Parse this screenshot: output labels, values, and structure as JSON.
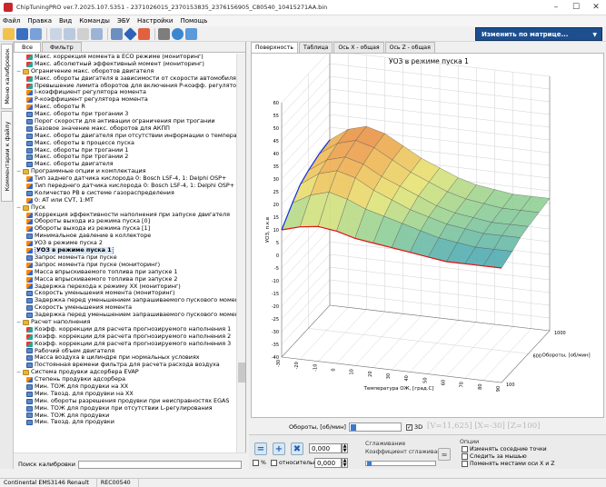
{
  "window": {
    "title": "ChipTuningPRO ver.7.2025.107.5351 - 237102601S_2370153835_2376156905_C80540_10415271AA.bin"
  },
  "menu": [
    "Файл",
    "Правка",
    "Вид",
    "Команды",
    "ЭБУ",
    "Настройки",
    "Помощь"
  ],
  "toolbar": {
    "change_matrix_label": "Изменить по матрице...",
    "change_matrix_arrow": "▼"
  },
  "side_tabs": {
    "calibrations": "Меню калибровок",
    "comments": "Комментарии к файлу"
  },
  "left_tabs": [
    "Все",
    "Фильтр"
  ],
  "tree": [
    {
      "depth": 2,
      "type": "map3d",
      "label": "Макс. коррекция момента в ECO режиме (мониторинг)"
    },
    {
      "depth": 2,
      "type": "map3d",
      "label": "Макс. абсолютный эффективный момент (мониторинг)"
    },
    {
      "depth": 1,
      "type": "folder",
      "toggle": "−",
      "label": "Ограничение макс. оборотов двигателя"
    },
    {
      "depth": 2,
      "type": "map3d",
      "label": "Макс. обороты двигателя в зависимости от скорости автомобиля"
    },
    {
      "depth": 2,
      "type": "map3d",
      "label": "Превышение лимита оборотов для включения P-коэфф. регулятора"
    },
    {
      "depth": 2,
      "type": "map2d",
      "label": "I-коэффициент регулятора момента"
    },
    {
      "depth": 2,
      "type": "map2d",
      "label": "P-коэффициент регулятора момента"
    },
    {
      "depth": 2,
      "type": "map2d",
      "label": "Макс. обороты R"
    },
    {
      "depth": 2,
      "type": "table",
      "label": "Макс. обороты при трогании 3"
    },
    {
      "depth": 2,
      "type": "table",
      "label": "Порог скорости для активации ограничения при трогании"
    },
    {
      "depth": 2,
      "type": "table",
      "label": "Базовое значение макс. оборотов для АКПП"
    },
    {
      "depth": 2,
      "type": "table",
      "label": "Макс. обороты двигателя при отсутствии  информации о температуре"
    },
    {
      "depth": 2,
      "type": "table",
      "label": "Макс. обороты в процессе пуска"
    },
    {
      "depth": 2,
      "type": "table",
      "label": "Макс. обороты при трогании 1"
    },
    {
      "depth": 2,
      "type": "table",
      "label": "Макс. обороты при трогании 2"
    },
    {
      "depth": 2,
      "type": "table",
      "label": "Макс. обороты двигателя"
    },
    {
      "depth": 1,
      "type": "folder",
      "toggle": "−",
      "label": "Программные опции и комплектация"
    },
    {
      "depth": 2,
      "type": "map2d",
      "label": "Тип заднего датчика кислорода 0: Bosch LSF-4, 1: Delphi OSP+"
    },
    {
      "depth": 2,
      "type": "map2d",
      "label": "Тип переднего датчика кислорода 0: Bosch LSF-4, 1: Delphi OSP+"
    },
    {
      "depth": 2,
      "type": "table",
      "label": "Количество РВ в системе газораспределения"
    },
    {
      "depth": 2,
      "type": "map2d",
      "label": "0: AT или CVT, 1:MT"
    },
    {
      "depth": 1,
      "type": "folder",
      "toggle": "−",
      "label": "Пуск"
    },
    {
      "depth": 2,
      "type": "map2d",
      "label": "Коррекция эффективности наполнения при запуске двигателя"
    },
    {
      "depth": 2,
      "type": "map2d",
      "label": "Обороты выхода из режима пуска [0]"
    },
    {
      "depth": 2,
      "type": "map2d",
      "label": "Обороты выхода из режима пуска [1]"
    },
    {
      "depth": 2,
      "type": "table",
      "label": "Минимальное давление в коллекторе"
    },
    {
      "depth": 2,
      "type": "map2d",
      "label": "УОЗ в режиме пуска 2"
    },
    {
      "depth": 2,
      "type": "map2d",
      "label": "УОЗ в режиме пуска 1",
      "selected": true
    },
    {
      "depth": 2,
      "type": "table",
      "label": "Запрос момента при пуске"
    },
    {
      "depth": 2,
      "type": "map2d",
      "label": "Запрос момента при пуске (мониторинг)"
    },
    {
      "depth": 2,
      "type": "map2d",
      "label": "Масса впрыскиваемого топлива при запуске 1"
    },
    {
      "depth": 2,
      "type": "map2d",
      "label": "Масса впрыскиваемого топлива при запуске 2"
    },
    {
      "depth": 2,
      "type": "map2d",
      "label": "Задержка перехода к режиму XX (мониторинг)"
    },
    {
      "depth": 2,
      "type": "table",
      "label": "Скорость уменьшения момента (мониторинг)"
    },
    {
      "depth": 2,
      "type": "table",
      "label": "Задержка перед уменьшением запрашиваемого пускового момента"
    },
    {
      "depth": 2,
      "type": "table",
      "label": "Скорость уменьшения момента"
    },
    {
      "depth": 2,
      "type": "table",
      "label": "Задержка перед уменьшением запрашиваемого пускового момента (мониторинг)"
    },
    {
      "depth": 1,
      "type": "folder",
      "toggle": "−",
      "label": "Расчет наполнения"
    },
    {
      "depth": 2,
      "type": "map3d",
      "label": "Коэфф. коррекции для расчета прогнозируемого наполнения 1"
    },
    {
      "depth": 2,
      "type": "map3d",
      "label": "Коэфф. коррекции для расчета прогнозируемого наполнения 2"
    },
    {
      "depth": 2,
      "type": "map3d",
      "label": "Коэфф. коррекции для расчета прогнозируемого наполнения 3"
    },
    {
      "depth": 2,
      "type": "table",
      "label": "Рабочий объем двигателя"
    },
    {
      "depth": 2,
      "type": "table",
      "label": "Масса воздуха в цилиндре при нормальных условиях"
    },
    {
      "depth": 2,
      "type": "table",
      "label": "Постоянная времени фильтра для расчета расхода воздуха"
    },
    {
      "depth": 1,
      "type": "folder",
      "toggle": "−",
      "label": "Система продувки адсорбера EVAP"
    },
    {
      "depth": 2,
      "type": "map2d",
      "label": "Степень продувки адсорбера"
    },
    {
      "depth": 2,
      "type": "table",
      "label": "Мин. ТОЖ для продувки на XX"
    },
    {
      "depth": 2,
      "type": "table",
      "label": "Мин. Твозд. для продувки на XX"
    },
    {
      "depth": 2,
      "type": "table",
      "label": "Мин. обороты разрешения продувки при неисправностях EGAS"
    },
    {
      "depth": 2,
      "type": "table",
      "label": "Мин. ТОЖ для продувки при отсутствии L-регулирования"
    },
    {
      "depth": 2,
      "type": "table",
      "label": "Мин. ТОЖ для продувки"
    },
    {
      "depth": 2,
      "type": "table",
      "label": "Мин. Твозд. для продувки"
    }
  ],
  "search": {
    "label": "Поиск калибровки",
    "value": ""
  },
  "right_tabs": [
    "Поверхность",
    "Таблица",
    "Ось X - общая",
    "Ось Z - общая"
  ],
  "chart_data": {
    "type": "surface",
    "title": "УОЗ в режиме пуска 1",
    "xlabel": "Температура ОЖ, [град.С]",
    "ylabel": "УОЗ, п.к.в",
    "zlabel": "Обороты, [об/мин]",
    "x_ticks": [
      -30,
      -20,
      -10,
      0,
      10,
      20,
      30,
      40,
      50,
      60,
      70,
      80,
      90
    ],
    "z_ticks": [
      100,
      600,
      1000
    ],
    "y_ticks": [
      -40,
      -35,
      -30,
      -25,
      -20,
      -15,
      -10,
      -5,
      0,
      5,
      10,
      15,
      20,
      25,
      30,
      35,
      40,
      45,
      50,
      55,
      60
    ],
    "ylim": [
      -40,
      60
    ],
    "xlim": [
      -30,
      90
    ],
    "zlim": [
      100,
      1000
    ],
    "rpm_rows": [
      100,
      300,
      450,
      600,
      800,
      1000
    ],
    "temp_cols": [
      -30,
      -20,
      -10,
      0,
      10,
      20,
      30,
      40,
      50,
      60,
      70,
      80,
      90
    ],
    "values": [
      [
        10,
        12,
        13,
        12,
        10,
        9,
        8,
        7,
        6,
        5,
        5,
        5,
        5
      ],
      [
        16,
        20,
        22,
        20,
        17,
        15,
        13,
        11,
        9,
        8,
        7,
        7,
        7
      ],
      [
        20,
        25,
        27,
        25,
        21,
        18,
        15,
        13,
        11,
        10,
        9,
        9,
        9
      ],
      [
        22,
        27,
        29,
        27,
        23,
        20,
        17,
        14,
        12,
        11,
        10,
        10,
        10
      ],
      [
        24,
        29,
        31,
        29,
        25,
        21,
        18,
        15,
        13,
        12,
        11,
        11,
        11
      ],
      [
        25,
        30,
        32,
        30,
        26,
        22,
        19,
        16,
        14,
        13,
        12,
        12,
        12
      ]
    ],
    "grid": true
  },
  "view": {
    "slider_label": "Обороты, [об/мин]",
    "chk3d_label": "3D",
    "chk3d_mark": "✓",
    "coords": "[V=11,625] [X=-30] [Z=100]"
  },
  "controls": {
    "btn_eq": "=",
    "btn_plus": "+",
    "btn_x": "✖",
    "value1": "0,000",
    "value2": "0,000",
    "percent_label": "%",
    "relative_label": "относительно",
    "smoothing_group": "Сглаживание",
    "smoothing_coef": "Коэффициент сглаживания",
    "options_group": "Опции",
    "opt1": "Изменять соседние точки",
    "opt2": "Следить за мышью",
    "opt3": "Поменять местами оси X и Z"
  },
  "status": {
    "ecu": "Continental EMS3146 Renault",
    "code": "REC00540"
  },
  "colors": {
    "accent": "#1d4f8f",
    "surface_hi": "#e89a4a",
    "surface_lo": "#4aa8b8",
    "edge_red": "#e01010",
    "edge_blue": "#1030e0"
  }
}
